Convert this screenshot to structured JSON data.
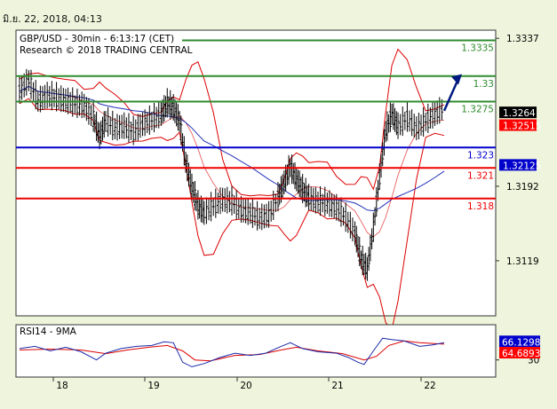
{
  "header": {
    "datetime": "มิ.ย. 22, 2018, 04:13"
  },
  "chart_data": [
    {
      "type": "line",
      "title": "GBP/USD - 30min - 6:13:17 (CET)",
      "subtitle": "Research © 2018 TRADING CENTRAL",
      "ylim": [
        1.3065,
        1.3345
      ],
      "x_days": [
        "18",
        "19",
        "20",
        "21",
        "22"
      ],
      "y_ticks": [
        1.3337,
        1.3192,
        1.3119
      ],
      "grid": false,
      "last_price": 1.3264,
      "price_markers": [
        {
          "label": "1.3264",
          "value": 1.3264,
          "color": "#000000"
        },
        {
          "label": "1.32515",
          "value": 1.32515,
          "color": "#ff0000"
        },
        {
          "label": "1.32125",
          "value": 1.32125,
          "color": "#0000cc"
        }
      ],
      "levels": [
        {
          "value": 1.3335,
          "label": "1.3335",
          "color": "#2e8b2e"
        },
        {
          "value": 1.33,
          "label": "1.33",
          "color": "#2e8b2e"
        },
        {
          "value": 1.3275,
          "label": "1.3275",
          "color": "#2e8b2e"
        },
        {
          "value": 1.323,
          "label": "1.323",
          "color": "#0000cc"
        },
        {
          "value": 1.321,
          "label": "1.321",
          "color": "#ee0000"
        },
        {
          "value": 1.318,
          "label": "1.318",
          "color": "#ee0000"
        }
      ],
      "price_path": [
        [
          0,
          1.3285
        ],
        [
          3,
          1.3295
        ],
        [
          6,
          1.3275
        ],
        [
          9,
          1.328
        ],
        [
          12,
          1.3278
        ],
        [
          15,
          1.3275
        ],
        [
          18,
          1.3272
        ],
        [
          21,
          1.327
        ],
        [
          24,
          1.3258
        ],
        [
          26,
          1.324
        ],
        [
          28,
          1.3255
        ],
        [
          31,
          1.3248
        ],
        [
          34,
          1.325
        ],
        [
          37,
          1.3245
        ],
        [
          40,
          1.3252
        ],
        [
          43,
          1.3256
        ],
        [
          46,
          1.3262
        ],
        [
          48,
          1.3272
        ],
        [
          50,
          1.3268
        ],
        [
          52,
          1.3255
        ],
        [
          54,
          1.3215
        ],
        [
          56,
          1.319
        ],
        [
          58,
          1.3172
        ],
        [
          60,
          1.3165
        ],
        [
          63,
          1.3172
        ],
        [
          66,
          1.3178
        ],
        [
          69,
          1.3176
        ],
        [
          72,
          1.3168
        ],
        [
          75,
          1.3165
        ],
        [
          78,
          1.316
        ],
        [
          81,
          1.3163
        ],
        [
          84,
          1.318
        ],
        [
          86,
          1.3195
        ],
        [
          88,
          1.321
        ],
        [
          90,
          1.3198
        ],
        [
          92,
          1.3188
        ],
        [
          94,
          1.318
        ],
        [
          97,
          1.3176
        ],
        [
          100,
          1.3175
        ],
        [
          103,
          1.317
        ],
        [
          106,
          1.316
        ],
        [
          109,
          1.3145
        ],
        [
          111,
          1.312
        ],
        [
          113,
          1.311
        ],
        [
          115,
          1.315
        ],
        [
          117,
          1.32
        ],
        [
          119,
          1.3245
        ],
        [
          121,
          1.3262
        ],
        [
          123,
          1.325
        ],
        [
          126,
          1.3258
        ],
        [
          129,
          1.3248
        ],
        [
          132,
          1.3255
        ],
        [
          135,
          1.3262
        ],
        [
          138,
          1.3268
        ]
      ],
      "price_range": [
        1.3255,
        1.3305
      ],
      "rsi": {
        "title": "RSI14 - 9MA",
        "ylim": [
          0,
          100
        ],
        "y_ticks": [
          30
        ],
        "last_value": 66.1298,
        "ma_value": 64.6893,
        "markers": [
          {
            "label": "66.1298",
            "color": "#0000cc",
            "value": 66.1298
          },
          {
            "label": "64.6893",
            "color": "#ff0000",
            "value": 64.6893
          }
        ],
        "rsi_path": [
          [
            0,
            55
          ],
          [
            5,
            60
          ],
          [
            10,
            50
          ],
          [
            15,
            58
          ],
          [
            20,
            48
          ],
          [
            25,
            30
          ],
          [
            28,
            45
          ],
          [
            33,
            55
          ],
          [
            38,
            60
          ],
          [
            43,
            62
          ],
          [
            47,
            70
          ],
          [
            50,
            68
          ],
          [
            53,
            25
          ],
          [
            56,
            15
          ],
          [
            60,
            22
          ],
          [
            65,
            35
          ],
          [
            70,
            45
          ],
          [
            75,
            40
          ],
          [
            80,
            45
          ],
          [
            85,
            60
          ],
          [
            88,
            68
          ],
          [
            92,
            55
          ],
          [
            97,
            48
          ],
          [
            103,
            45
          ],
          [
            107,
            35
          ],
          [
            110,
            25
          ],
          [
            112,
            20
          ],
          [
            115,
            50
          ],
          [
            118,
            78
          ],
          [
            121,
            75
          ],
          [
            125,
            72
          ],
          [
            130,
            60
          ],
          [
            134,
            63
          ],
          [
            138,
            68
          ]
        ],
        "ma_path": [
          [
            0,
            52
          ],
          [
            10,
            54
          ],
          [
            20,
            52
          ],
          [
            28,
            44
          ],
          [
            35,
            52
          ],
          [
            42,
            58
          ],
          [
            48,
            62
          ],
          [
            53,
            50
          ],
          [
            57,
            30
          ],
          [
            62,
            28
          ],
          [
            70,
            40
          ],
          [
            78,
            42
          ],
          [
            85,
            52
          ],
          [
            90,
            58
          ],
          [
            97,
            50
          ],
          [
            105,
            44
          ],
          [
            112,
            30
          ],
          [
            116,
            38
          ],
          [
            120,
            62
          ],
          [
            125,
            72
          ],
          [
            130,
            68
          ],
          [
            138,
            65
          ]
        ]
      }
    }
  ]
}
